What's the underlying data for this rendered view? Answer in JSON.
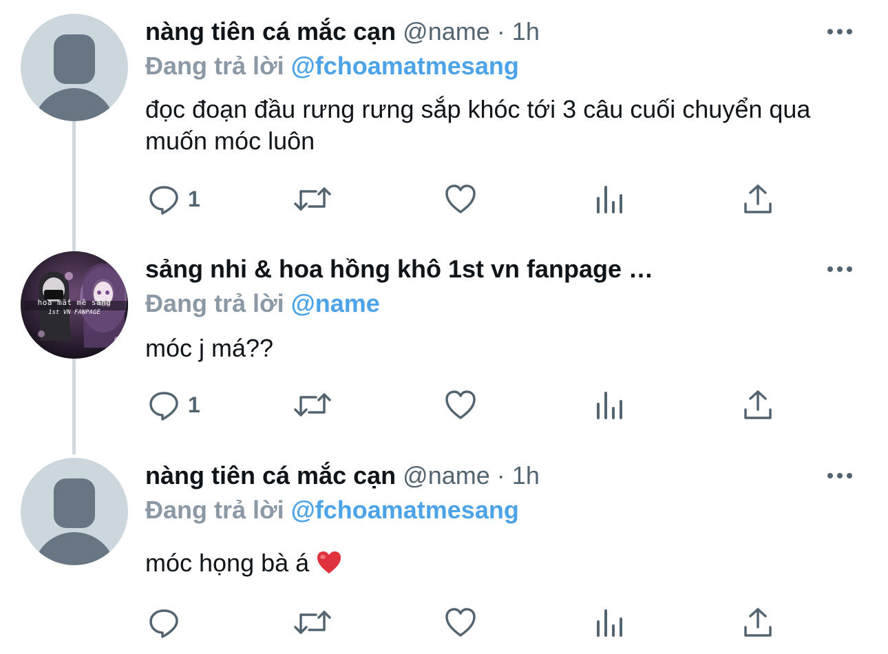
{
  "tweets": [
    {
      "name": "nàng tiên cá mắc cạn",
      "handle": "@name",
      "separator": "·",
      "time": "1h",
      "reply_label": "Đang trả lời",
      "reply_mention": "@fchoamatmesang",
      "text": "đọc đoạn đầu rưng rưng sắp khóc tới 3 câu cuối chuyển qua muốn móc luôn",
      "reply_count": "1",
      "avatar_icon": "default-profile-icon"
    },
    {
      "name": "sảng nhi & hoa hồng khô 1st vn fanpage …",
      "reply_label": "Đang trả lời",
      "reply_mention": "@name",
      "text": "móc j má??",
      "reply_count": "1",
      "avatar_text": "hoa mắt mê sảng",
      "avatar_subtext": "1st VN FANPAGE"
    },
    {
      "name": "nàng tiên cá mắc cạn",
      "handle": "@name",
      "separator": "·",
      "time": "1h",
      "reply_label": "Đang trả lời",
      "reply_mention": "@fchoamatmesang",
      "text": "móc họng bà á",
      "reply_count": "",
      "emoji": "red-heart-emoji",
      "avatar_icon": "default-profile-icon"
    }
  ],
  "colors": {
    "text": "#0f1419",
    "secondary": "#536471",
    "mention": "#4ca3e8",
    "thread_line": "#cfd9de"
  }
}
